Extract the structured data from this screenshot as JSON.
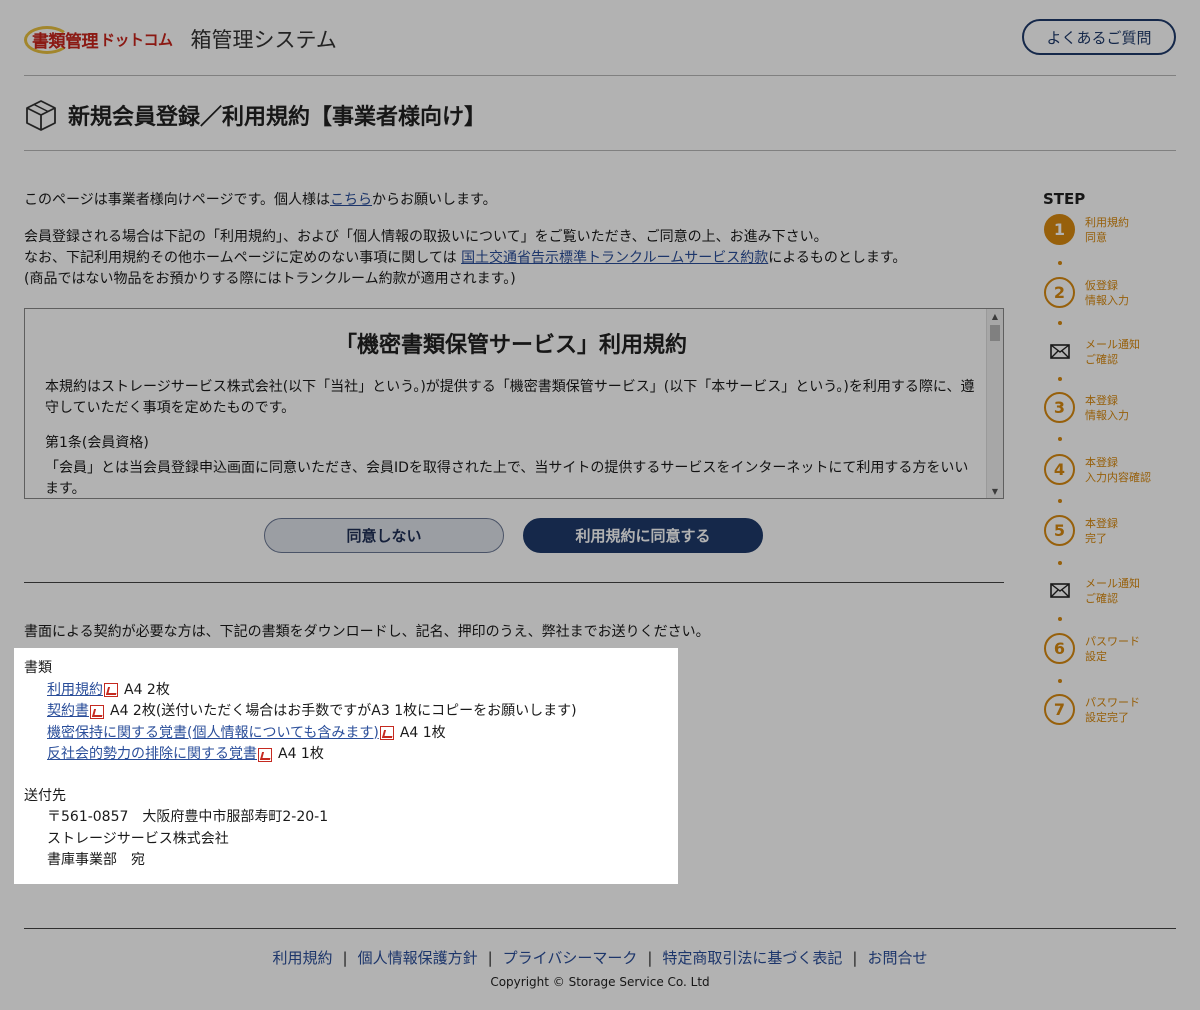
{
  "header": {
    "logo_red": "書類管理",
    "logo_dotcom": "ドットコム",
    "logo_system": "箱管理システム",
    "faq_label": "よくあるご質問"
  },
  "page_title": "新規会員登録／利用規約【事業者様向け】",
  "intro": {
    "line1_before": "このページは事業者様向けページです。個人様は",
    "line1_link": "こちら",
    "line1_after": "からお願いします。",
    "line2": "会員登録される場合は下記の「利用規約」、および「個人情報の取扱いについて」をご覧いただき、ご同意の上、お進み下さい。",
    "line3_before": "なお、下記利用規約その他ホームページに定めのない事項に関しては ",
    "line3_link": "国土交通省告示標準トランクルームサービス約款",
    "line3_after": "によるものとします。",
    "line4": "(商品ではない物品をお預かりする際にはトランクルーム約款が適用されます。)"
  },
  "terms": {
    "title": "「機密書類保管サービス」利用規約",
    "para1": "本規約はストレージサービス株式会社(以下「当社」という。)が提供する「機密書類保管サービス」(以下「本サービス」という。)を利用する際に、遵守していただく事項を定めたものです。",
    "article1_title": "第1条(会員資格)",
    "article1_body": "「会員」とは当会員登録申込画面に同意いただき、会員IDを取得された上で、当サイトの提供するサービスをインターネットにて利用する方をいいます。"
  },
  "buttons": {
    "disagree": "同意しない",
    "agree": "利用規約に同意する"
  },
  "paper_note": "書面による契約が必要な方は、下記の書類をダウンロードし、記名、押印のうえ、弊社までお送りください。",
  "documents": {
    "heading": "書類",
    "items": [
      {
        "link": "利用規約",
        "note": "A4 2枚"
      },
      {
        "link": "契約書",
        "note": "A4 2枚(送付いただく場合はお手数ですがA3 1枚にコピーをお願いします)"
      },
      {
        "link": "機密保持に関する覚書(個人情報についても含みます)",
        "note": "A4 1枚"
      },
      {
        "link": "反社会的勢力の排除に関する覚書",
        "note": "A4 1枚"
      }
    ]
  },
  "address": {
    "heading": "送付先",
    "line1": "〒561-0857　大阪府豊中市服部寿町2-20-1",
    "line2": "ストレージサービス株式会社",
    "line3": "書庫事業部　宛"
  },
  "steps": {
    "heading": "STEP",
    "items": [
      {
        "marker": "1",
        "label1": "利用規約",
        "label2": "同意",
        "active": true
      },
      {
        "marker": "2",
        "label1": "仮登録",
        "label2": "情報入力"
      },
      {
        "marker": "mail",
        "label1": "メール通知",
        "label2": "ご確認"
      },
      {
        "marker": "3",
        "label1": "本登録",
        "label2": "情報入力"
      },
      {
        "marker": "4",
        "label1": "本登録",
        "label2": "入力内容確認"
      },
      {
        "marker": "5",
        "label1": "本登録",
        "label2": "完了"
      },
      {
        "marker": "mail",
        "label1": "メール通知",
        "label2": "ご確認"
      },
      {
        "marker": "6",
        "label1": "パスワード",
        "label2": "設定"
      },
      {
        "marker": "7",
        "label1": "パスワード",
        "label2": "設定完了"
      }
    ]
  },
  "footer": {
    "links": [
      "利用規約",
      "個人情報保護方針",
      "プライバシーマーク",
      "特定商取引法に基づく表記",
      "お問合せ"
    ],
    "separator": "|",
    "copyright": "Copyright © Storage Service Co. Ltd"
  },
  "colors": {
    "navy": "#1f3a6b",
    "step_orange": "#d88a10",
    "link_blue": "#2a4e9a",
    "logo_red": "#c8241c"
  }
}
